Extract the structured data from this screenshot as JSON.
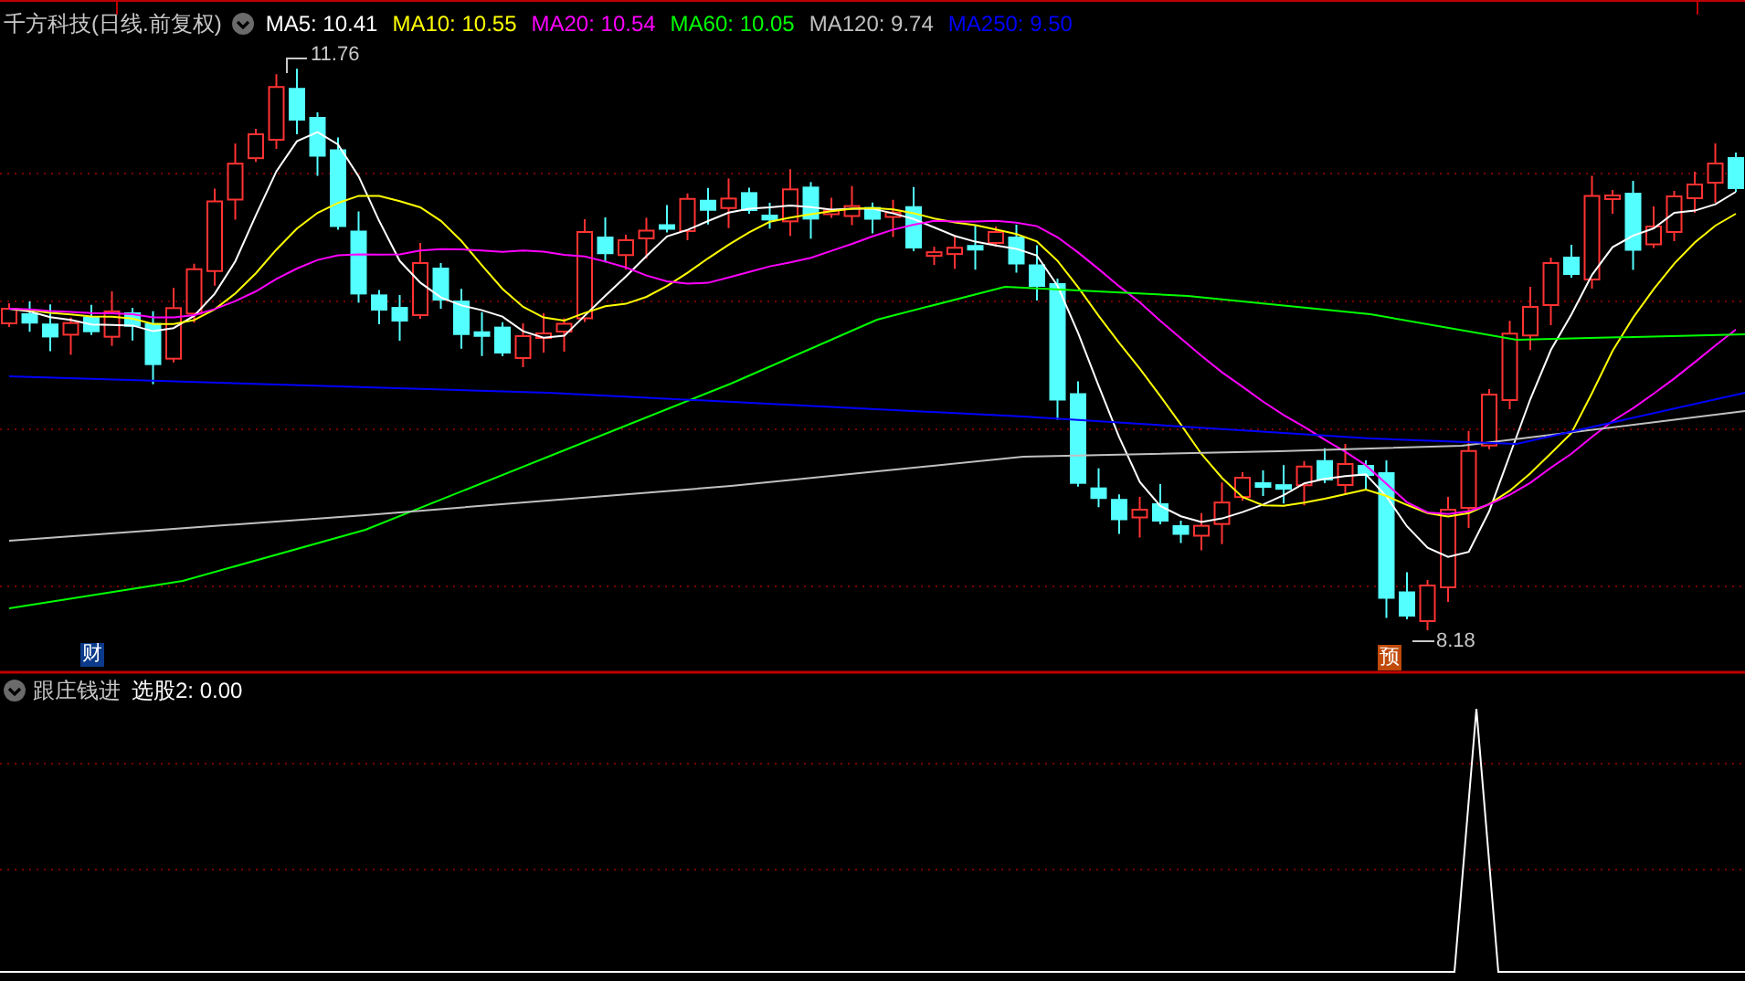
{
  "main_panel": {
    "title": "千方科技(日线.前复权)",
    "indicators": [
      {
        "label": "MA5: 10.41",
        "color": "#ffffff"
      },
      {
        "label": "MA10: 10.55",
        "color": "#ffff00"
      },
      {
        "label": "MA20: 10.54",
        "color": "#ff00ff"
      },
      {
        "label": "MA60: 10.05",
        "color": "#00ff00"
      },
      {
        "label": "MA120: 9.74",
        "color": "#c0c0c0"
      },
      {
        "label": "MA250: 9.50",
        "color": "#0000ff"
      }
    ],
    "high_label": "11.76",
    "low_label": "8.18",
    "badges": [
      {
        "text": "财",
        "kind": "finance"
      },
      {
        "text": "预",
        "kind": "forecast"
      }
    ]
  },
  "sub_panel": {
    "title": "跟庄钱进",
    "reading": "选股2: 0.00"
  }
}
